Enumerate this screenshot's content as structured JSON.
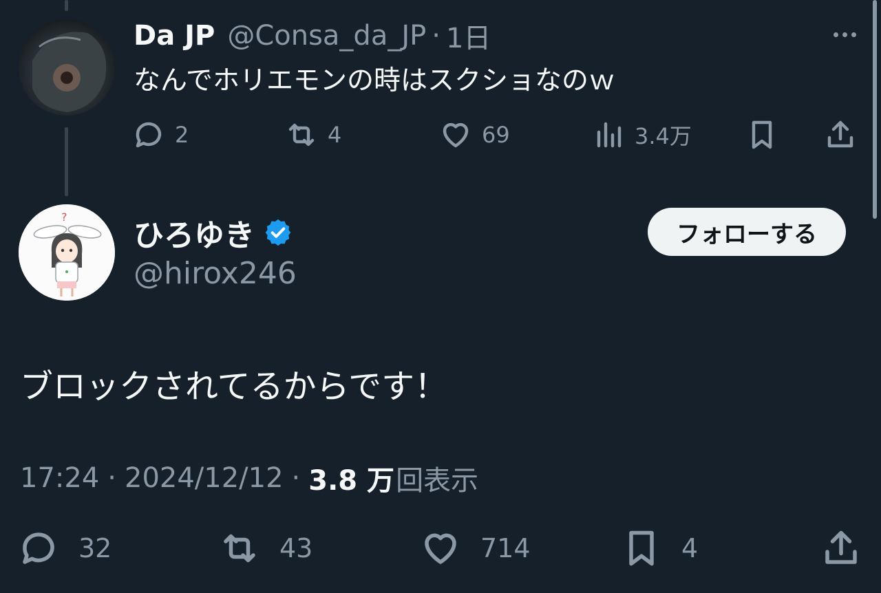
{
  "reply_tweet": {
    "display_name": "Da JP",
    "handle": "@Consa_da_JP",
    "separator": "·",
    "time": "1日",
    "text": "なんでホリエモンの時はスクショなのｗ",
    "actions": {
      "replies": "2",
      "retweets": "4",
      "likes": "69",
      "views": "3.4万"
    }
  },
  "main_tweet": {
    "display_name": "ひろゆき",
    "handle": "@hirox246",
    "follow_label": "フォローする",
    "text": "ブロックされてるからです！",
    "meta": {
      "time": "17:24",
      "separator": "·",
      "date": "2024/12/12",
      "views_count": "3.8 万",
      "views_label": "回表示"
    },
    "actions": {
      "replies": "32",
      "retweets": "43",
      "likes": "714",
      "bookmarks": "4"
    }
  },
  "colors": {
    "background": "#15202b",
    "text_primary": "#f7f9f9",
    "text_secondary": "#8b98a5",
    "verified_blue": "#1d9bf0",
    "follow_button_bg": "#eff3f4"
  },
  "icons": [
    "more-icon",
    "reply-icon",
    "retweet-icon",
    "like-icon",
    "views-icon",
    "bookmark-icon",
    "share-icon",
    "verified-badge-icon"
  ]
}
